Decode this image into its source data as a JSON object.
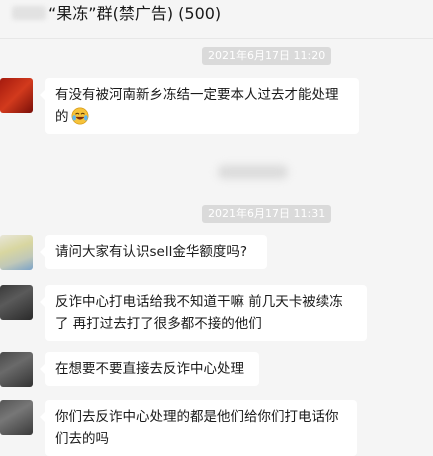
{
  "chat": {
    "title": "“果冻”群(禁广告) (500)"
  },
  "timestamps": [
    "2021年6月17日 11:20",
    "2021年6月17日 11:31"
  ],
  "messages": [
    {
      "lines": [
        "有没有被河南新乡冻结一定要本人过去才能处理",
        "的"
      ],
      "emoji": "laughing-crying-emoji"
    },
    {
      "lines": [
        "请问大家有认识sell金华额度吗?"
      ]
    },
    {
      "lines": [
        "反诈中心打电话给我不知道干嘛 前几天卡被续冻",
        "了 再打过去打了很多都不接的他们"
      ]
    },
    {
      "lines": [
        "在想要不要直接去反诈中心处理"
      ]
    },
    {
      "lines": [
        "你们去反诈中心处理的都是他们给你们打电话你",
        "们去的吗"
      ]
    }
  ]
}
